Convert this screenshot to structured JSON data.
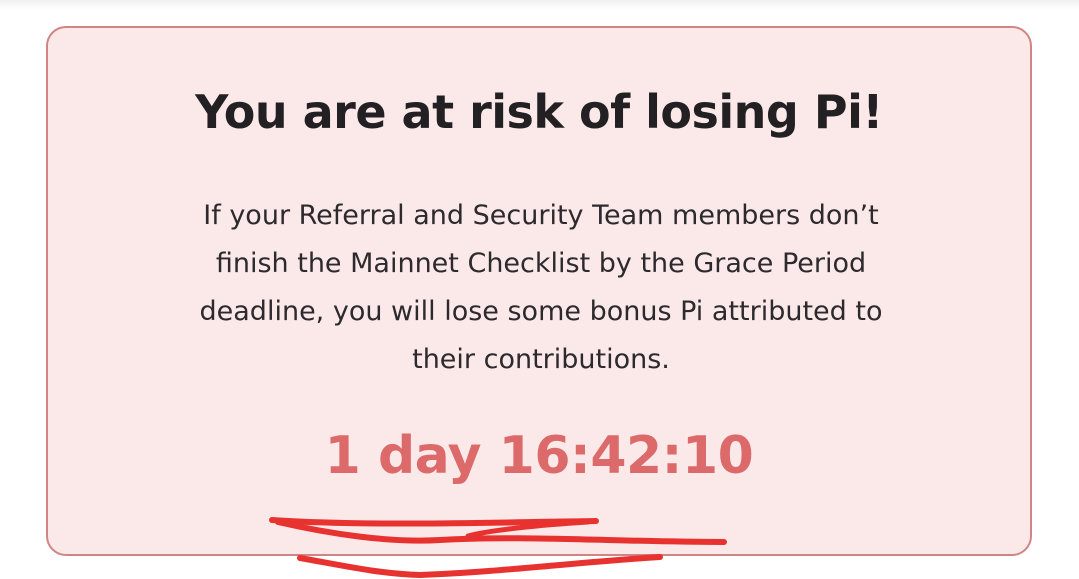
{
  "alert": {
    "title": "You are at risk of losing Pi!",
    "body_lines": [
      "If your Referral and Security Team members don’t",
      "finish the Mainnet Checklist by the Grace Period",
      "deadline, you will lose some bonus Pi attributed to",
      "their contributions."
    ],
    "countdown": "1 day 16:42:10"
  },
  "colors": {
    "card_background": "#fbe9ea",
    "card_border": "#d08585",
    "title_text": "#232023",
    "countdown_text": "#dd6a6a",
    "annotation_stroke": "#e8322f"
  }
}
